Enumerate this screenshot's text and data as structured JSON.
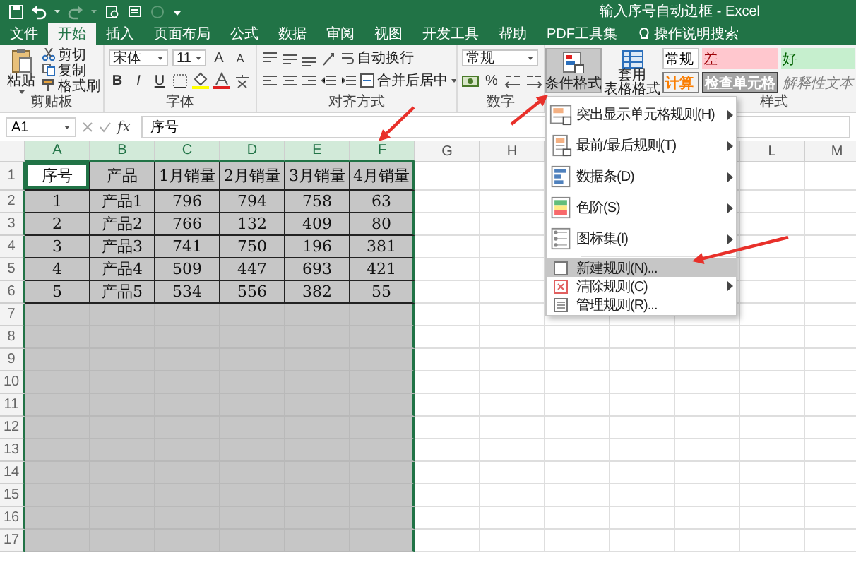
{
  "title_bar": {
    "title": "输入序号自动边框 - Excel"
  },
  "tabs": [
    {
      "label": "文件",
      "selected": false
    },
    {
      "label": "开始",
      "selected": true
    },
    {
      "label": "插入",
      "selected": false
    },
    {
      "label": "页面布局",
      "selected": false
    },
    {
      "label": "公式",
      "selected": false
    },
    {
      "label": "数据",
      "selected": false
    },
    {
      "label": "审阅",
      "selected": false
    },
    {
      "label": "视图",
      "selected": false
    },
    {
      "label": "开发工具",
      "selected": false
    },
    {
      "label": "帮助",
      "selected": false
    },
    {
      "label": "PDF工具集",
      "selected": false
    }
  ],
  "tell_me": "操作说明搜索",
  "ribbon": {
    "clipboard": {
      "paste": "粘贴",
      "cut": "剪切",
      "copy": "复制",
      "format_painter": "格式刷",
      "label": "剪贴板"
    },
    "font": {
      "font_name": "宋体",
      "font_size": "11",
      "grow": "A",
      "shrink": "A",
      "styles": [
        "B",
        "I",
        "U"
      ],
      "label": "字体"
    },
    "alignment": {
      "wrap_text": "自动换行",
      "merge_center": "合并后居中",
      "label": "对齐方式"
    },
    "number": {
      "format": "常规",
      "percent": "%",
      "label": "数字"
    },
    "conditional_formatting": {
      "label": "条件格式",
      "expanded": true
    },
    "format_as_table": {
      "lines": [
        "套用",
        "表格格式"
      ]
    },
    "cell_styles": [
      {
        "label": "常规",
        "kind": "normal"
      },
      {
        "label": "差",
        "kind": "bad"
      },
      {
        "label": "好",
        "kind": "good"
      },
      {
        "label": "计算",
        "kind": "calculation"
      },
      {
        "label": "检查单元格",
        "kind": "check"
      },
      {
        "label": "解释性文本",
        "kind": "explanatory"
      }
    ],
    "styles_label": "样式"
  },
  "formula_bar": {
    "name_box": "A1",
    "fx": "fx",
    "value": "序号"
  },
  "sheet": {
    "columns": [
      {
        "label": "A",
        "selected": true
      },
      {
        "label": "B",
        "selected": true
      },
      {
        "label": "C",
        "selected": true
      },
      {
        "label": "D",
        "selected": true
      },
      {
        "label": "E",
        "selected": true
      },
      {
        "label": "F",
        "selected": true
      },
      {
        "label": "G",
        "selected": false
      },
      {
        "label": "H",
        "selected": false
      },
      {
        "label": "L",
        "selected": false
      },
      {
        "label": "M",
        "selected": false
      }
    ],
    "row_numbers": [
      "1",
      "2",
      "3",
      "4",
      "5",
      "6",
      "7",
      "8",
      "9",
      "10",
      "11",
      "12",
      "13",
      "14",
      "15",
      "16",
      "17"
    ],
    "rows": [
      {
        "cells": [
          {
            "text": "序号",
            "active": true
          },
          {
            "text": "产品",
            "active": false
          },
          {
            "text": "1月销量",
            "active": false
          },
          {
            "text": "2月销量",
            "active": false
          },
          {
            "text": "3月销量",
            "active": false
          },
          {
            "text": "4月销量",
            "active": false
          }
        ]
      },
      {
        "cells": [
          {
            "text": "1",
            "active": false
          },
          {
            "text": "产品1",
            "active": false
          },
          {
            "text": "796",
            "active": false
          },
          {
            "text": "794",
            "active": false
          },
          {
            "text": "758",
            "active": false
          },
          {
            "text": "63",
            "active": false
          }
        ]
      },
      {
        "cells": [
          {
            "text": "2",
            "active": false
          },
          {
            "text": "产品2",
            "active": false
          },
          {
            "text": "766",
            "active": false
          },
          {
            "text": "132",
            "active": false
          },
          {
            "text": "409",
            "active": false
          },
          {
            "text": "80",
            "active": false
          }
        ]
      },
      {
        "cells": [
          {
            "text": "3",
            "active": false
          },
          {
            "text": "产品3",
            "active": false
          },
          {
            "text": "741",
            "active": false
          },
          {
            "text": "750",
            "active": false
          },
          {
            "text": "196",
            "active": false
          },
          {
            "text": "381",
            "active": false
          }
        ]
      },
      {
        "cells": [
          {
            "text": "4",
            "active": false
          },
          {
            "text": "产品4",
            "active": false
          },
          {
            "text": "509",
            "active": false
          },
          {
            "text": "447",
            "active": false
          },
          {
            "text": "693",
            "active": false
          },
          {
            "text": "421",
            "active": false
          }
        ]
      },
      {
        "cells": [
          {
            "text": "5",
            "active": false
          },
          {
            "text": "产品5",
            "active": false
          },
          {
            "text": "534",
            "active": false
          },
          {
            "text": "556",
            "active": false
          },
          {
            "text": "382",
            "active": false
          },
          {
            "text": "55",
            "active": false
          }
        ]
      }
    ]
  },
  "menu": {
    "items": [
      {
        "label": "突出显示单元格规则(H)",
        "kind": "large",
        "submenu": true,
        "selected": false
      },
      {
        "label": "最前/最后规则(T)",
        "kind": "large",
        "submenu": true,
        "selected": false
      },
      {
        "label": "数据条(D)",
        "kind": "large",
        "submenu": true,
        "selected": false
      },
      {
        "label": "色阶(S)",
        "kind": "large",
        "submenu": true,
        "selected": false
      },
      {
        "label": "图标集(I)",
        "kind": "large",
        "submenu": true,
        "selected": false
      },
      {
        "label": "新建规则(N)...",
        "kind": "small",
        "submenu": false,
        "selected": true
      },
      {
        "label": "清除规则(C)",
        "kind": "small",
        "submenu": true,
        "selected": false
      },
      {
        "label": "管理规则(R)...",
        "kind": "small",
        "submenu": false,
        "selected": false
      }
    ]
  }
}
